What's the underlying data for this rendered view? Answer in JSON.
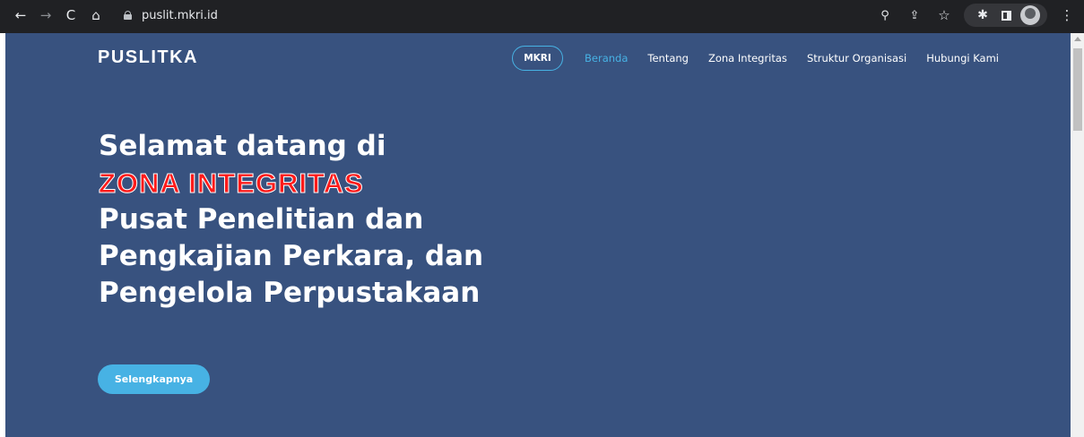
{
  "browser": {
    "url": "puslit.mkri.id",
    "icons": [
      "back-icon",
      "forward-icon",
      "reload-icon",
      "home-icon",
      "lock-icon",
      "zoom-icon",
      "share-icon",
      "bookmark-star-icon",
      "extensions-icon",
      "side-panel-icon",
      "profile-avatar",
      "menu-kebab-icon"
    ]
  },
  "site": {
    "logo": "PUSLITKA",
    "nav": {
      "mkri": "MKRI",
      "items": [
        "Beranda",
        "Tentang",
        "Zona Integritas",
        "Struktur Organisasi",
        "Hubungi Kami"
      ],
      "active": "Beranda"
    },
    "hero": {
      "line1": "Selamat datang di",
      "highlight": "ZONA INTEGRITAS",
      "line3": "Pusat Penelitian dan",
      "line4": "Pengkajian Perkara, dan",
      "line5": "Pengelola Perpustakaan"
    },
    "cta": "Selengkapnya"
  },
  "colors": {
    "chrome_bg": "#202124",
    "page_bg": "#38527f",
    "accent": "#47b2e4",
    "highlight_red": "#ff1a1a"
  }
}
